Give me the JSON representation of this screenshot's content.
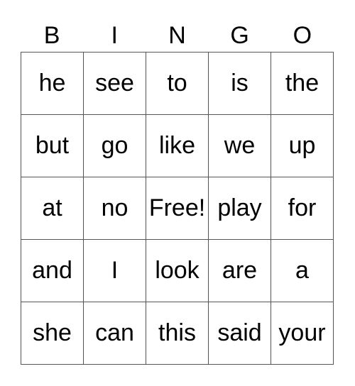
{
  "header": [
    "B",
    "I",
    "N",
    "G",
    "O"
  ],
  "rows": [
    [
      "he",
      "see",
      "to",
      "is",
      "the"
    ],
    [
      "but",
      "go",
      "like",
      "we",
      "up"
    ],
    [
      "at",
      "no",
      "Free!",
      "play",
      "for"
    ],
    [
      "and",
      "I",
      "look",
      "are",
      "a"
    ],
    [
      "she",
      "can",
      "this",
      "said",
      "your"
    ]
  ]
}
